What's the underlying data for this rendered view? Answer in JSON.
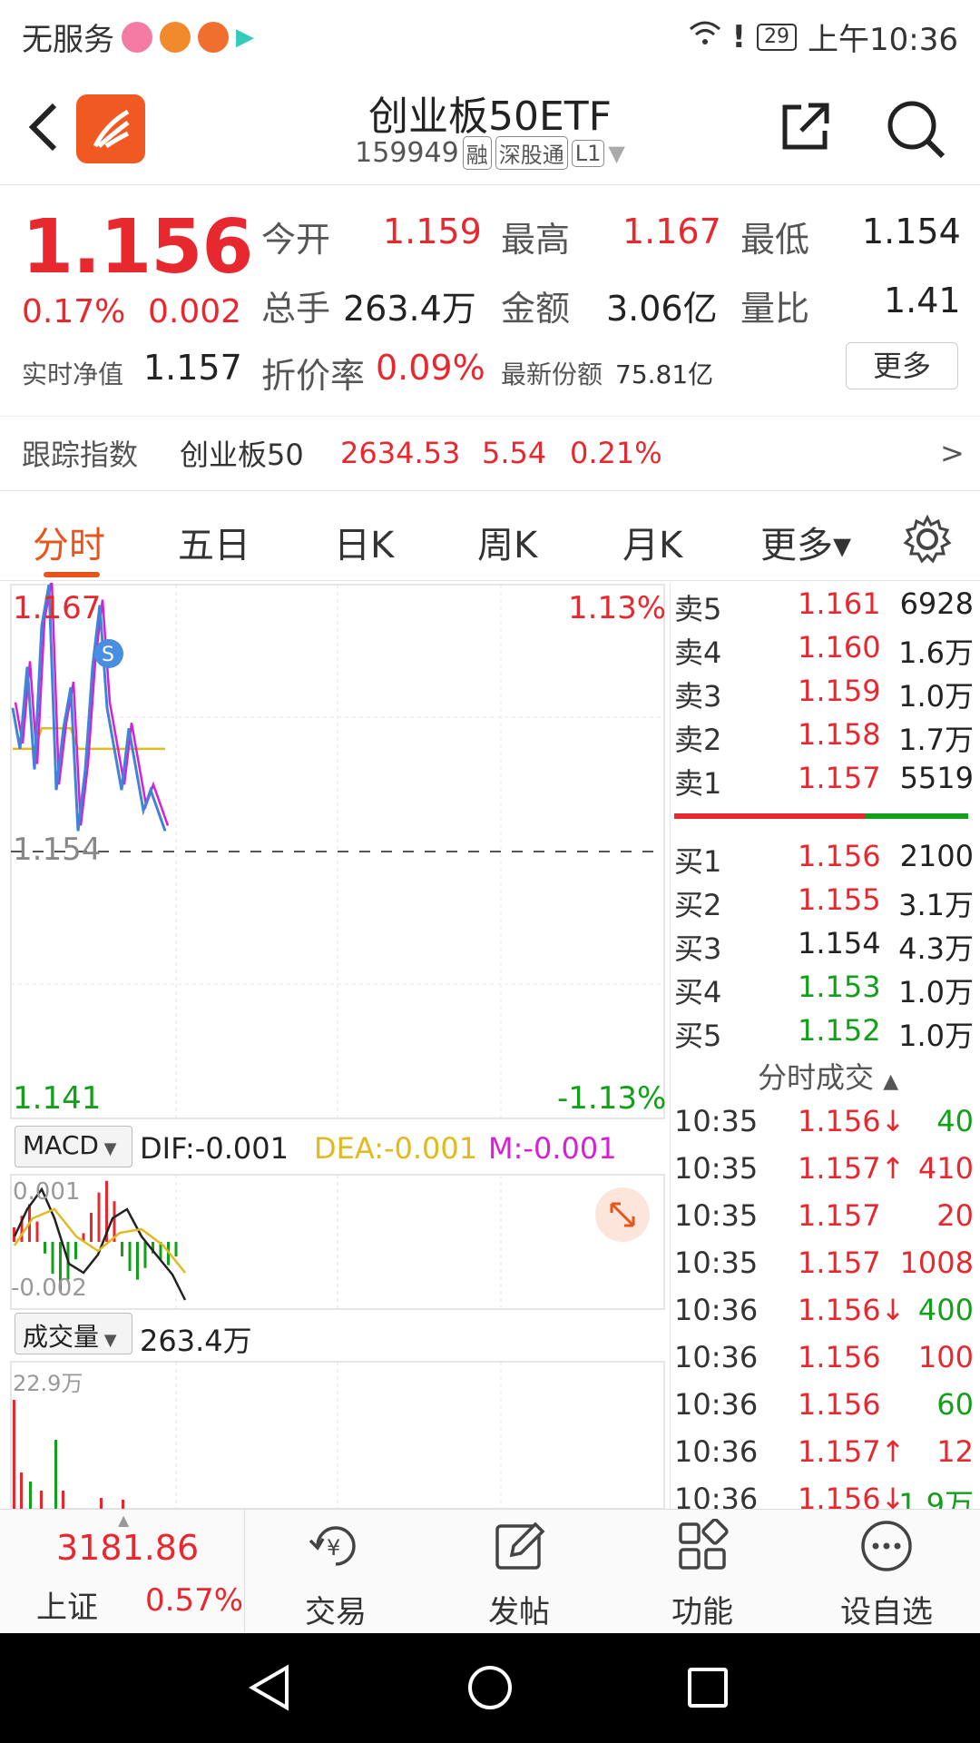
{
  "status_bar": {
    "carrier": "无服务",
    "battery": "29",
    "time": "上午10:36"
  },
  "header": {
    "title": "创业板50ETF",
    "code": "159949",
    "tags": [
      "融",
      "深股通",
      "L1"
    ]
  },
  "quote": {
    "price": "1.156",
    "change_pct": "0.17%",
    "change_abs": "0.002",
    "open_label": "今开",
    "open": "1.159",
    "high_label": "最高",
    "high": "1.167",
    "low_label": "最低",
    "low": "1.154",
    "volume_label": "总手",
    "volume": "263.4万",
    "amount_label": "金额",
    "amount": "3.06亿",
    "vol_ratio_label": "量比",
    "vol_ratio": "1.41",
    "nav_label": "实时净值",
    "nav": "1.157",
    "discount_label": "折价率",
    "discount": "0.09%",
    "shares_label": "最新份额",
    "shares": "75.81亿",
    "more_label": "更多"
  },
  "tracking": {
    "label": "跟踪指数",
    "index_name": "创业板50",
    "index_value": "2634.53",
    "index_change": "5.54",
    "index_pct": "0.21%",
    "arrow": ">"
  },
  "tabs": [
    {
      "label": "分时",
      "active": true
    },
    {
      "label": "五日"
    },
    {
      "label": "日K"
    },
    {
      "label": "周K"
    },
    {
      "label": "月K"
    },
    {
      "label": "更多▾"
    }
  ],
  "intraday_chart": {
    "top_price": "1.167",
    "top_pct": "1.13%",
    "mid_price": "1.154",
    "bottom_price": "1.141",
    "bottom_pct": "-1.13%",
    "indicator_name": "MACD",
    "dif": "DIF:-0.001",
    "dea": "DEA:-0.001",
    "m": "M:-0.001",
    "macd_top": "0.001",
    "macd_bottom": "-0.002",
    "volume_name": "成交量",
    "volume_total": "263.4万",
    "volume_max": "22.9万",
    "price_line": [
      1.161,
      1.159,
      1.163,
      1.158,
      1.165,
      1.167,
      1.157,
      1.16,
      1.162,
      1.155,
      1.158,
      1.163,
      1.166,
      1.161,
      1.159,
      1.157,
      1.16,
      1.158,
      1.156,
      1.157,
      1.156,
      1.155
    ],
    "avg_line": [
      1.159,
      1.159,
      1.159,
      1.159,
      1.16,
      1.16,
      1.16,
      1.16,
      1.16,
      1.159,
      1.159,
      1.159,
      1.159,
      1.159,
      1.159,
      1.159,
      1.159,
      1.159,
      1.159,
      1.159,
      1.159,
      1.159
    ]
  },
  "order_book": {
    "asks": [
      {
        "label": "卖5",
        "price": "1.161",
        "vol": "6928"
      },
      {
        "label": "卖4",
        "price": "1.160",
        "vol": "1.6万"
      },
      {
        "label": "卖3",
        "price": "1.159",
        "vol": "1.0万"
      },
      {
        "label": "卖2",
        "price": "1.158",
        "vol": "1.7万"
      },
      {
        "label": "卖1",
        "price": "1.157",
        "vol": "5519"
      }
    ],
    "bids": [
      {
        "label": "买1",
        "price": "1.156",
        "vol": "2100"
      },
      {
        "label": "买2",
        "price": "1.155",
        "vol": "3.1万"
      },
      {
        "label": "买3",
        "price": "1.154",
        "vol": "4.3万"
      },
      {
        "label": "买4",
        "price": "1.153",
        "vol": "1.0万"
      },
      {
        "label": "买5",
        "price": "1.152",
        "vol": "1.0万"
      }
    ],
    "trades_title": "分时成交",
    "trades": [
      {
        "time": "10:35",
        "price": "1.156↓",
        "vol": "40",
        "dir": "down"
      },
      {
        "time": "10:35",
        "price": "1.157↑",
        "vol": "410",
        "dir": "up"
      },
      {
        "time": "10:35",
        "price": "1.157",
        "vol": "20",
        "dir": "up"
      },
      {
        "time": "10:35",
        "price": "1.157",
        "vol": "1008",
        "dir": "up"
      },
      {
        "time": "10:36",
        "price": "1.156↓",
        "vol": "400",
        "dir": "down"
      },
      {
        "time": "10:36",
        "price": "1.156",
        "vol": "100",
        "dir": "up"
      },
      {
        "time": "10:36",
        "price": "1.156",
        "vol": "60",
        "dir": "down"
      },
      {
        "time": "10:36",
        "price": "1.157↑",
        "vol": "12",
        "dir": "up"
      },
      {
        "time": "10:36",
        "price": "1.156↓",
        "vol": "1.9万",
        "dir": "down"
      }
    ]
  },
  "bottom_bar": {
    "index_value": "3181.86",
    "index_name": "上证",
    "index_pct": "0.57%",
    "items": [
      {
        "label": "交易",
        "icon": "yuan-cycle-icon"
      },
      {
        "label": "发帖",
        "icon": "edit-icon"
      },
      {
        "label": "功能",
        "icon": "grid-icon"
      },
      {
        "label": "设自选",
        "icon": "more-dots-icon"
      }
    ]
  }
}
